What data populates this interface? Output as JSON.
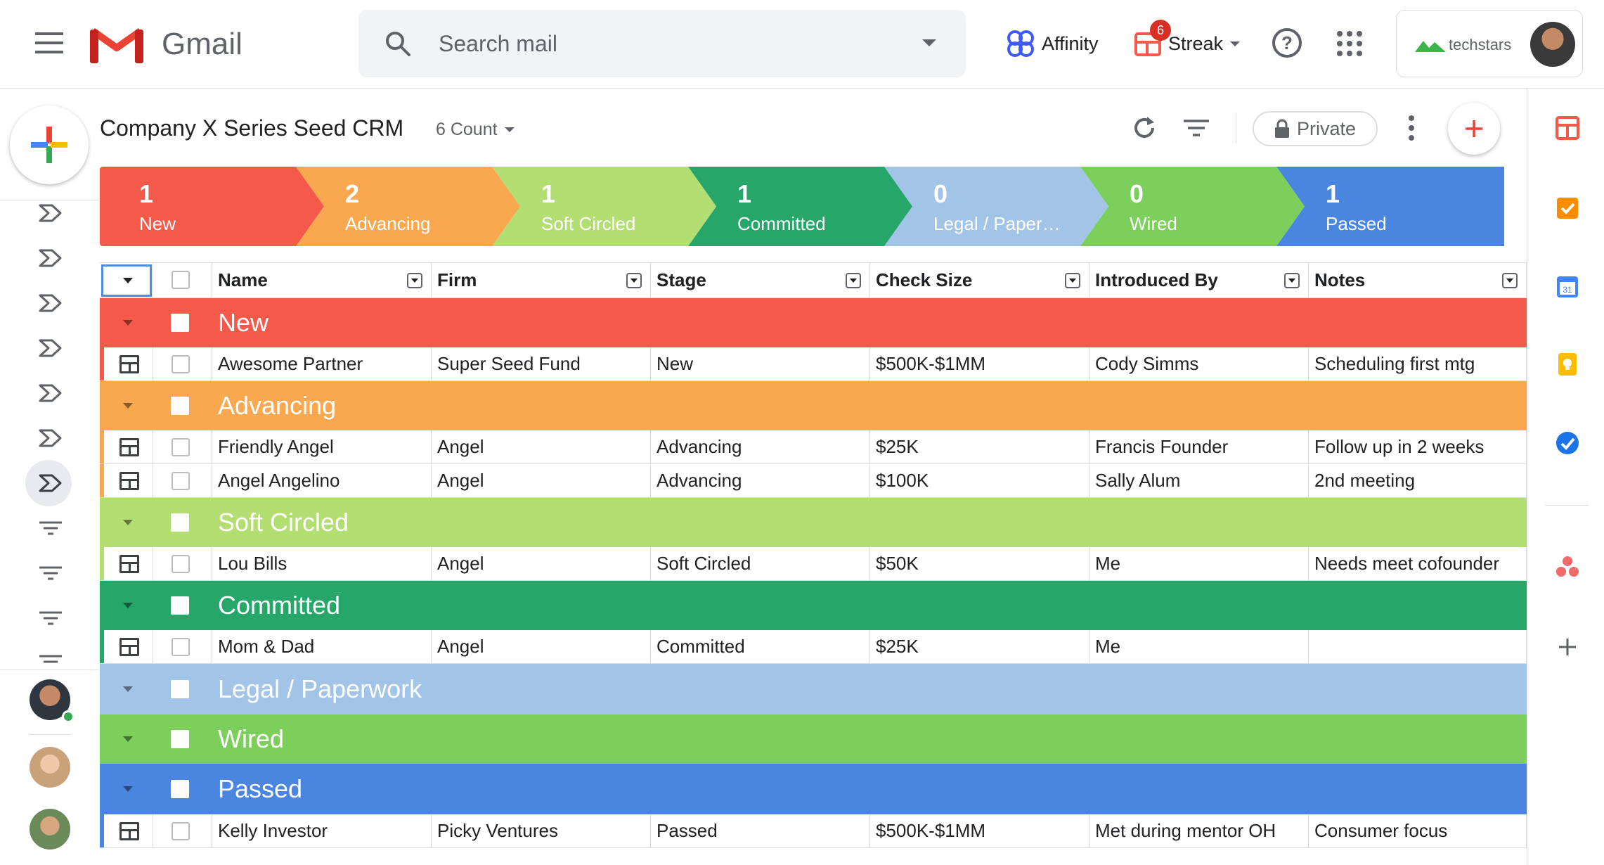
{
  "topbar": {
    "app_name": "Gmail",
    "search_placeholder": "Search mail",
    "affinity_label": "Affinity",
    "streak_label": "Streak",
    "streak_badge": "6",
    "account_org": "techstars"
  },
  "toolbar": {
    "title": "Company X Series Seed CRM",
    "count_label": "6 Count",
    "private_label": "Private"
  },
  "pipeline": [
    {
      "count": "1",
      "label": "New",
      "color": "#f4594a"
    },
    {
      "count": "2",
      "label": "Advancing",
      "color": "#f9a84f"
    },
    {
      "count": "1",
      "label": "Soft Circled",
      "color": "#b3de72"
    },
    {
      "count": "1",
      "label": "Committed",
      "color": "#27a66a"
    },
    {
      "count": "0",
      "label": "Legal / Paper…",
      "color": "#a2c4e6"
    },
    {
      "count": "0",
      "label": "Wired",
      "color": "#7ccf5a"
    },
    {
      "count": "1",
      "label": "Passed",
      "color": "#4a86e0"
    }
  ],
  "table": {
    "columns": [
      "Name",
      "Firm",
      "Stage",
      "Check Size",
      "Introduced By",
      "Notes"
    ],
    "groups": [
      {
        "name": "New",
        "color": "#f4594a",
        "rows": [
          [
            "Awesome Partner",
            "Super Seed Fund",
            "New",
            "$500K-$1MM",
            "Cody Simms",
            "Scheduling first mtg"
          ]
        ]
      },
      {
        "name": "Advancing",
        "color": "#f9a84f",
        "rows": [
          [
            "Friendly Angel",
            "Angel",
            "Advancing",
            "$25K",
            "Francis Founder",
            "Follow up in 2 weeks"
          ],
          [
            "Angel Angelino",
            "Angel",
            "Advancing",
            "$100K",
            "Sally Alum",
            "2nd meeting"
          ]
        ]
      },
      {
        "name": "Soft Circled",
        "color": "#b3de72",
        "rows": [
          [
            "Lou Bills",
            "Angel",
            "Soft Circled",
            "$50K",
            "Me",
            "Needs meet cofounder"
          ]
        ]
      },
      {
        "name": "Committed",
        "color": "#27a66a",
        "rows": [
          [
            "Mom & Dad",
            "Angel",
            "Committed",
            "$25K",
            "Me",
            ""
          ]
        ]
      },
      {
        "name": "Legal / Paperwork",
        "color": "#a2c4e6",
        "rows": []
      },
      {
        "name": "Wired",
        "color": "#7ccf5a",
        "rows": []
      },
      {
        "name": "Passed",
        "color": "#4a86e0",
        "rows": [
          [
            "Kelly Investor",
            "Picky Ventures",
            "Passed",
            "$500K-$1MM",
            "Met during mentor OH",
            "Consumer focus"
          ]
        ]
      }
    ]
  }
}
